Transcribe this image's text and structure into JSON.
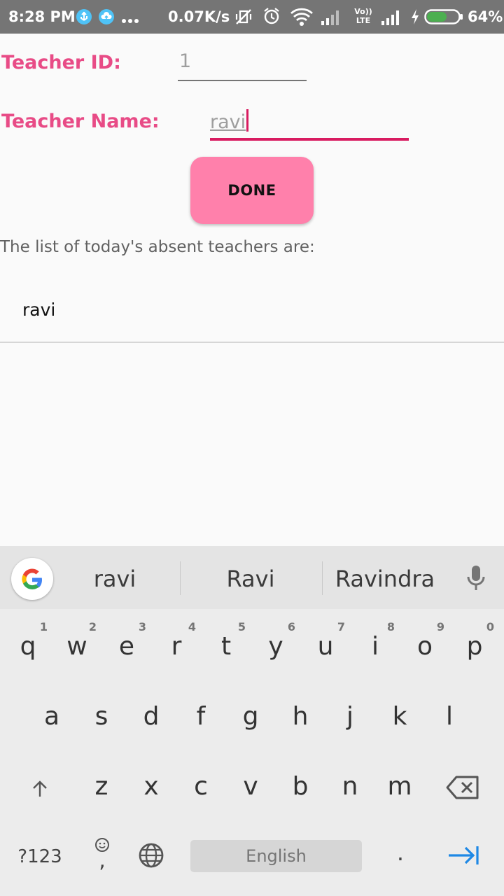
{
  "status_bar": {
    "time": "8:28 PM",
    "left_icons": [
      "usb-debug-icon",
      "cloud-upload-icon",
      "more-dots-icon"
    ],
    "network_speed": "0.07K/s",
    "right_icons": [
      "vibrate-mute-icon",
      "alarm-icon",
      "wifi-icon",
      "signal-icon",
      "volte-icon",
      "signal-icon",
      "charging-icon",
      "battery-icon"
    ],
    "volte_line1": "Vo))",
    "volte_line2": "LTE",
    "battery_percent": "64%",
    "battery_level": 0.64
  },
  "form": {
    "teacher_id_label": "Teacher ID:",
    "teacher_id_value": "1",
    "teacher_name_label": "Teacher Name:",
    "teacher_name_value": "ravi",
    "done_label": "DONE",
    "accent_color": "#e84b86",
    "button_color": "#ff80ab"
  },
  "absent": {
    "caption": "The list of today's absent teachers are:",
    "items": [
      "ravi"
    ]
  },
  "keyboard": {
    "suggestions": [
      "ravi",
      "Ravi",
      "Ravindra"
    ],
    "row1": [
      "q",
      "w",
      "e",
      "r",
      "t",
      "y",
      "u",
      "i",
      "o",
      "p"
    ],
    "row1_hints": [
      "1",
      "2",
      "3",
      "4",
      "5",
      "6",
      "7",
      "8",
      "9",
      "0"
    ],
    "row2": [
      "a",
      "s",
      "d",
      "f",
      "g",
      "h",
      "j",
      "k",
      "l"
    ],
    "row3": [
      "z",
      "x",
      "c",
      "v",
      "b",
      "n",
      "m"
    ],
    "symbols_label": "?123",
    "comma_label": ",",
    "space_label": "English",
    "period_label": ".",
    "icons": [
      "google-icon",
      "mic-icon",
      "shift-icon",
      "backspace-icon",
      "emoji-icon",
      "globe-icon",
      "enter-icon"
    ]
  }
}
